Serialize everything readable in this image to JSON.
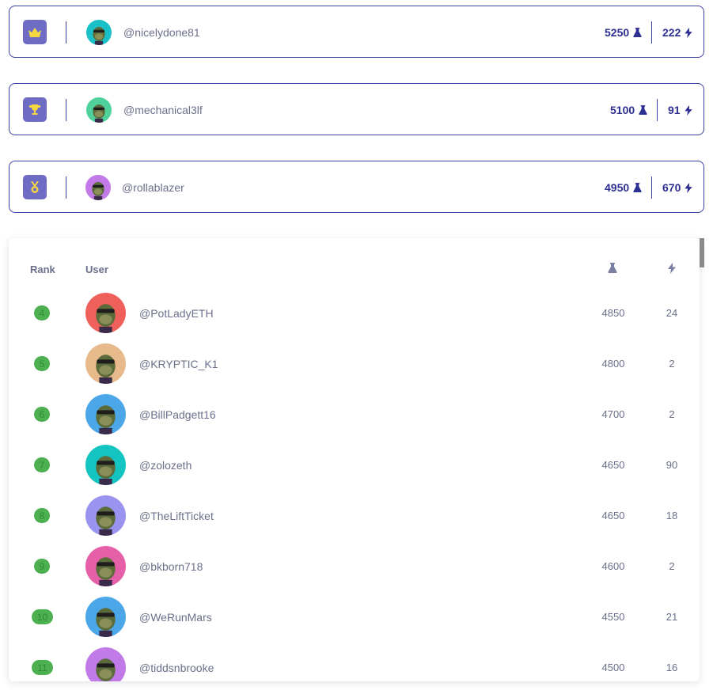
{
  "colors": {
    "accent": "#2e2f92",
    "border": "#3b3f9e",
    "icon_bg": "#6f6cc4",
    "rank_green": "#4caf50",
    "gold": "#f5d742"
  },
  "podium": [
    {
      "icon": "crown-icon",
      "handle": "@nicelydone81",
      "points": "5250",
      "bolts": "222",
      "avatar_bg": "#19c0c8"
    },
    {
      "icon": "trophy-icon",
      "handle": "@mechanical3lf",
      "points": "5100",
      "bolts": "91",
      "avatar_bg": "#4fd19c"
    },
    {
      "icon": "medal-icon",
      "handle": "@rollablazer",
      "points": "4950",
      "bolts": "670",
      "avatar_bg": "#c27ae8"
    }
  ],
  "table": {
    "headers": {
      "rank": "Rank",
      "user": "User",
      "points_icon": "flask-icon",
      "bolts_icon": "bolt-icon"
    },
    "rows": [
      {
        "rank": "4",
        "handle": "@PotLadyETH",
        "points": "4850",
        "bolts": "24",
        "avatar_bg": "#f0605a"
      },
      {
        "rank": "5",
        "handle": "@KRYPTIC_K1",
        "points": "4800",
        "bolts": "2",
        "avatar_bg": "#e8b98a"
      },
      {
        "rank": "6",
        "handle": "@BillPadgett16",
        "points": "4700",
        "bolts": "2",
        "avatar_bg": "#4ba7e8"
      },
      {
        "rank": "7",
        "handle": "@zolozeth",
        "points": "4650",
        "bolts": "90",
        "avatar_bg": "#14c4c0"
      },
      {
        "rank": "8",
        "handle": "@TheLiftTicket",
        "points": "4650",
        "bolts": "18",
        "avatar_bg": "#9a94f0"
      },
      {
        "rank": "9",
        "handle": "@bkborn718",
        "points": "4600",
        "bolts": "2",
        "avatar_bg": "#e560a8"
      },
      {
        "rank": "10",
        "handle": "@WeRunMars",
        "points": "4550",
        "bolts": "21",
        "avatar_bg": "#4ba7e8"
      },
      {
        "rank": "11",
        "handle": "@tiddsnbrooke",
        "points": "4500",
        "bolts": "16",
        "avatar_bg": "#c27ae8"
      }
    ]
  }
}
